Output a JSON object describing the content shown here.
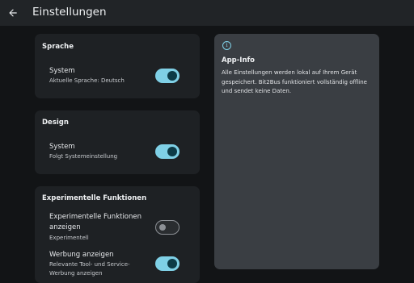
{
  "header": {
    "title": "Einstellungen"
  },
  "sections": {
    "language": {
      "title": "Sprache",
      "item_title": "System",
      "item_subtitle": "Aktuelle Sprache: Deutsch",
      "enabled": true
    },
    "design": {
      "title": "Design",
      "item_title": "System",
      "item_subtitle": "Folgt Systemeinstellung",
      "enabled": true
    },
    "experimental": {
      "title": "Experimentelle Funktionen",
      "items": [
        {
          "title_line1": "Experimentelle Funktionen",
          "title_line2": "anzeigen",
          "subtitle": "Experimentell",
          "enabled": false
        },
        {
          "title_line1": "Werbung anzeigen",
          "subtitle_line1": "Relevante Tool- und Service-",
          "subtitle_line2": "Werbung anzeigen",
          "enabled": true
        }
      ]
    }
  },
  "info": {
    "title": "App-Info",
    "icon": "info-icon",
    "text": "Alle Einstellungen werden lokal auf Ihrem Gerät gespeichert. Bit2Bus funktioniert vollständig offline und sendet keine Daten."
  },
  "colors": {
    "background": "#121416",
    "topbar": "#212427",
    "card": "#1e2124",
    "info_panel": "#3a3e43",
    "accent": "#7fd0e6"
  }
}
